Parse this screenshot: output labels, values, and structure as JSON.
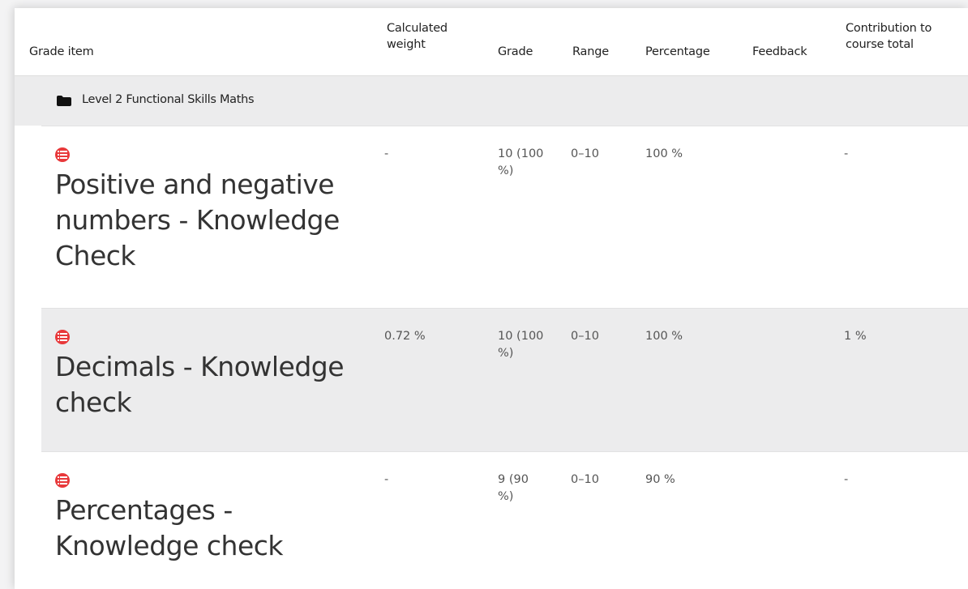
{
  "table": {
    "headers": {
      "grade_item": "Grade item",
      "calculated_weight": "Calculated weight",
      "grade": "Grade",
      "range": "Range",
      "percentage": "Percentage",
      "feedback": "Feedback",
      "contribution": "Contribution to course total"
    },
    "category": {
      "icon": "folder-icon",
      "name": "Level 2 Functional Skills Maths"
    },
    "rows": [
      {
        "icon": "quiz-icon",
        "name": "Positive and negative numbers - Knowledge Check",
        "calculated_weight": "-",
        "grade": "10 (100 %)",
        "range": "0–10",
        "percentage": "100 %",
        "feedback": "",
        "contribution": "-"
      },
      {
        "icon": "quiz-icon",
        "name": "Decimals - Knowledge check",
        "calculated_weight": "0.72 %",
        "grade": "10 (100 %)",
        "range": "0–10",
        "percentage": "100 %",
        "feedback": "",
        "contribution": "1 %"
      },
      {
        "icon": "quiz-icon",
        "name": "Percentages - Knowledge check",
        "calculated_weight": "-",
        "grade": "9 (90 %)",
        "range": "0–10",
        "percentage": "90 %",
        "feedback": "",
        "contribution": "-"
      }
    ]
  },
  "colors": {
    "quiz_icon": "#e8383a",
    "row_alt_background": "#ececed"
  }
}
